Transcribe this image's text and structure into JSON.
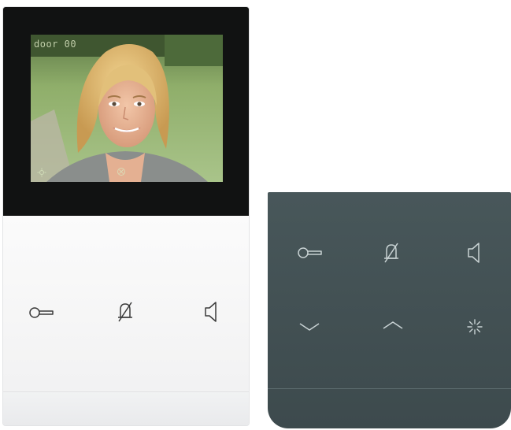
{
  "device": {
    "osd_label": "door 00",
    "colors": {
      "bezel": "#111212",
      "white_panel": "#f4f4f5",
      "dark_panel": "#46555a",
      "white_icon": "#3a3a3a",
      "dark_icon": "#c9d3d4"
    }
  },
  "white_keypad": {
    "buttons": [
      {
        "name": "door-open",
        "icon": "key-icon"
      },
      {
        "name": "mute",
        "icon": "bell-off-icon"
      },
      {
        "name": "speaker",
        "icon": "speaker-icon"
      }
    ]
  },
  "dark_keypad": {
    "buttons": [
      {
        "name": "door-open",
        "icon": "key-icon"
      },
      {
        "name": "mute",
        "icon": "bell-off-icon"
      },
      {
        "name": "speaker",
        "icon": "speaker-icon"
      },
      {
        "name": "down",
        "icon": "chevron-down-icon"
      },
      {
        "name": "up",
        "icon": "chevron-up-icon"
      },
      {
        "name": "light",
        "icon": "light-icon"
      }
    ]
  }
}
